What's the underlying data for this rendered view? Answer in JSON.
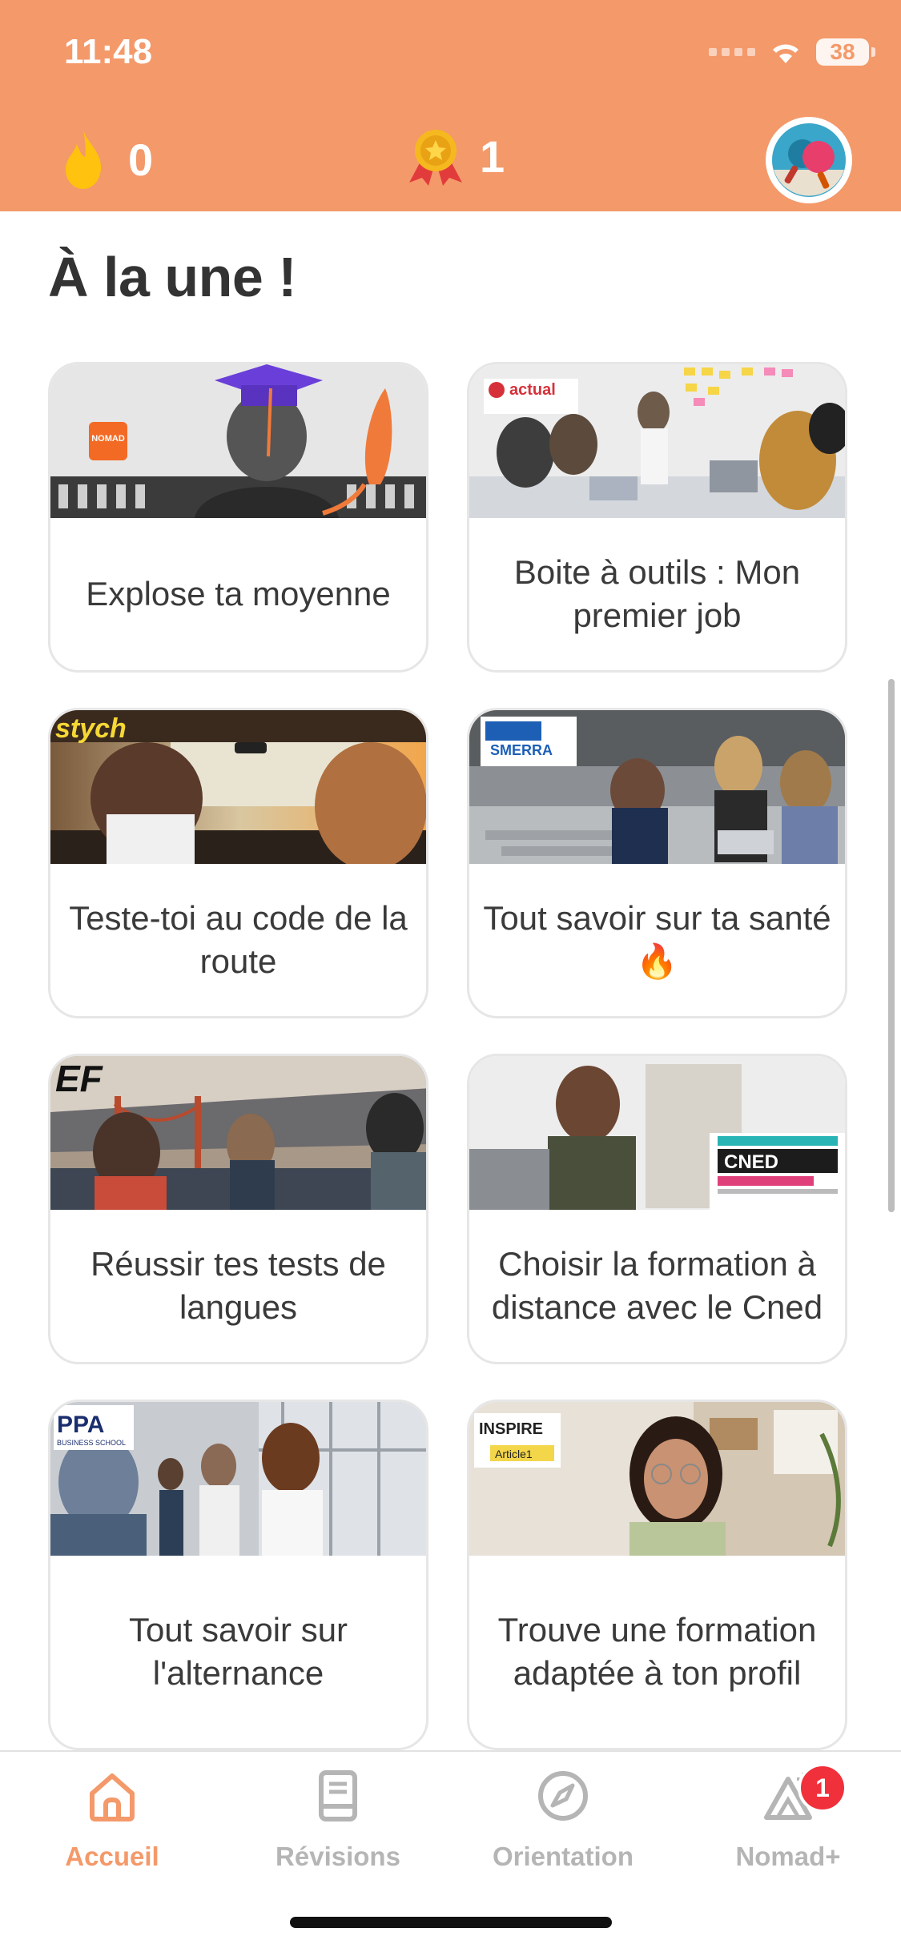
{
  "status": {
    "time": "11:48",
    "battery": "38"
  },
  "header": {
    "streak_count": "0",
    "medal_count": "1"
  },
  "section": {
    "title": "À la une !"
  },
  "cards": [
    {
      "label": "Explose ta moyenne",
      "logo": "NOMAD"
    },
    {
      "label": "Boite à outils : Mon premier job",
      "logo": "actual"
    },
    {
      "label": "Teste-toi au code de la route",
      "logo": "stych"
    },
    {
      "label": "Tout savoir sur ta santé 🔥",
      "logo": "SMERRA"
    },
    {
      "label": "Réussir tes tests de langues",
      "logo": "EF"
    },
    {
      "label": "Choisir la formation à distance avec le Cned",
      "logo": "CNED"
    },
    {
      "label": "Tout savoir sur l'alternance",
      "logo": "PPA"
    },
    {
      "label": "Trouve une formation adaptée à ton profil",
      "logo": "INSPIRE"
    }
  ],
  "tabs": [
    {
      "label": "Accueil",
      "icon": "home-icon",
      "active": true
    },
    {
      "label": "Révisions",
      "icon": "book-icon"
    },
    {
      "label": "Orientation",
      "icon": "compass-icon"
    },
    {
      "label": "Nomad+",
      "icon": "nomad-plus-icon",
      "badge": "1"
    }
  ],
  "colors": {
    "accent": "#F4996A",
    "badge": "#F0303B"
  }
}
